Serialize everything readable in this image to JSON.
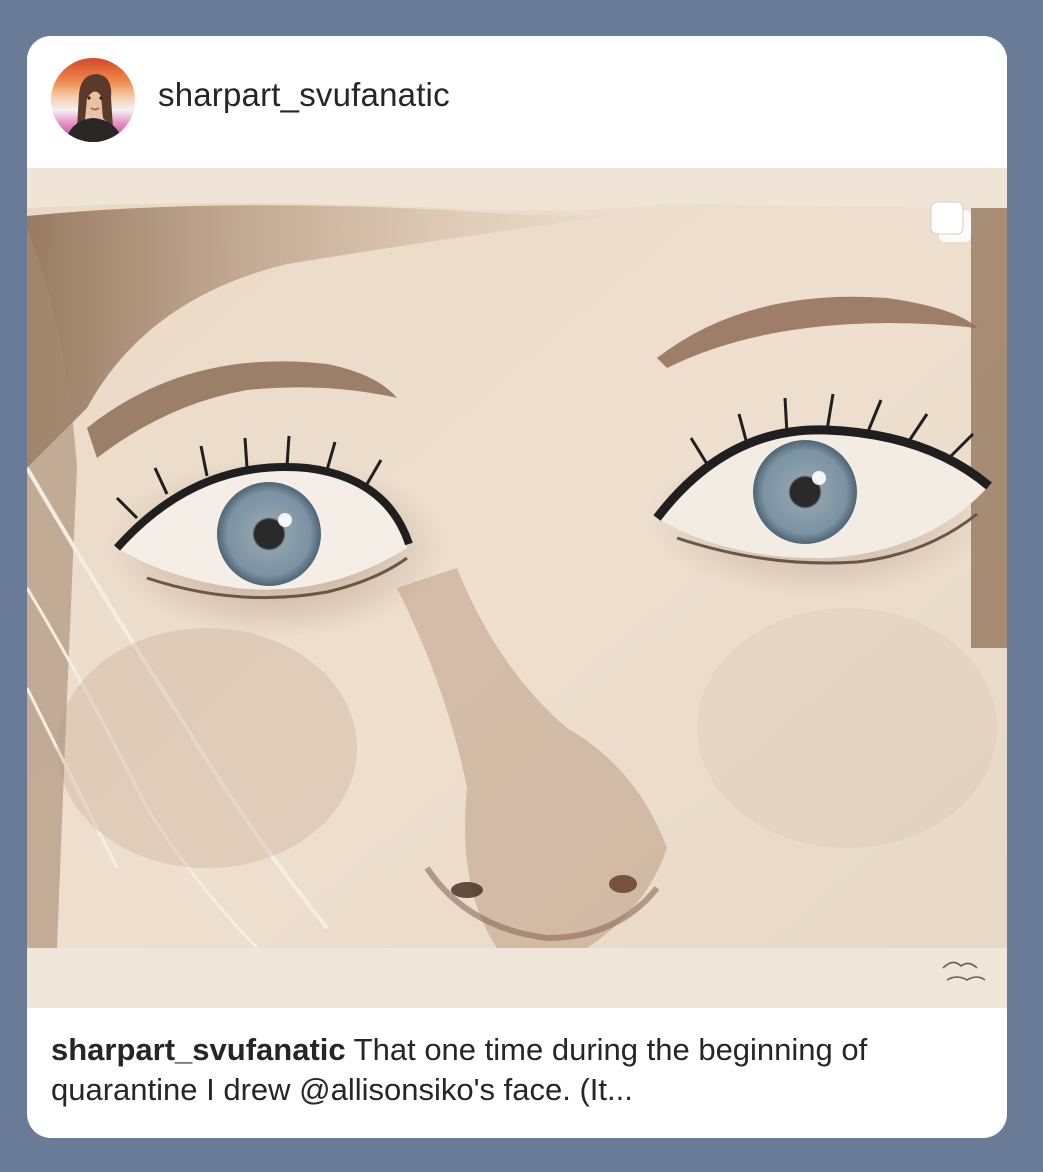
{
  "post": {
    "username": "sharpart_svufanatic",
    "caption_username": "sharpart_svufanatic",
    "caption_text": " That one time during the beginning of quarantine I drew @allisonsiko's face. (It..."
  },
  "icons": {
    "multi_image": "carousel-stack-icon",
    "avatar": "profile-photo"
  },
  "colors": {
    "background": "#6a7b98",
    "card": "#ffffff",
    "text": "#262626",
    "avatar_ring_top": "#d8502e",
    "avatar_ring_mid": "#f3a46c",
    "avatar_ring_bottom": "#c14a9a"
  }
}
